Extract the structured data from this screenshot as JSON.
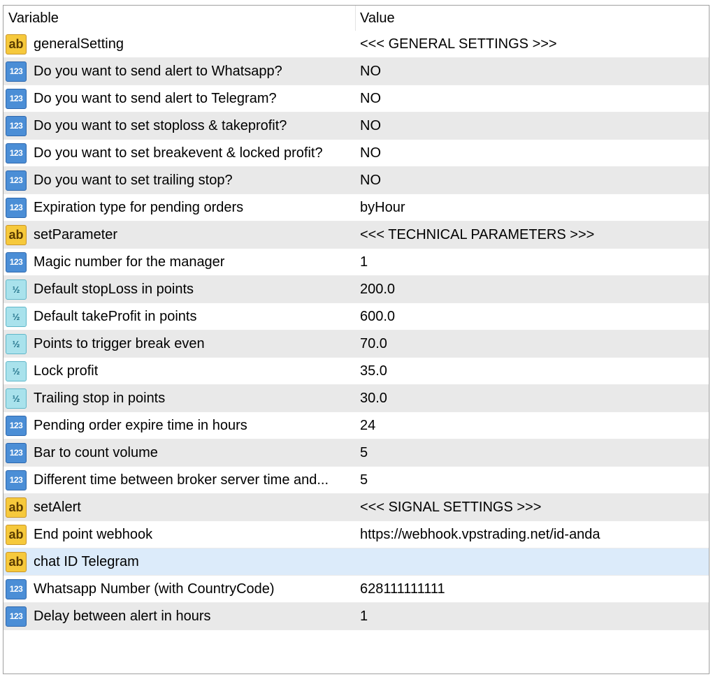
{
  "header": {
    "variable": "Variable",
    "value": "Value"
  },
  "rows": [
    {
      "type": "ab",
      "variable": "generalSetting",
      "value": "<<< GENERAL SETTINGS >>>"
    },
    {
      "type": "num",
      "variable": "Do you want to send alert to Whatsapp?",
      "value": "NO"
    },
    {
      "type": "num",
      "variable": "Do you want to send alert to Telegram?",
      "value": "NO"
    },
    {
      "type": "num",
      "variable": "Do you want to set stoploss & takeprofit?",
      "value": "NO"
    },
    {
      "type": "num",
      "variable": "Do you want to set breakevent & locked profit?",
      "value": "NO"
    },
    {
      "type": "num",
      "variable": "Do you want to set trailing stop?",
      "value": "NO"
    },
    {
      "type": "num",
      "variable": "Expiration type for pending orders",
      "value": "byHour"
    },
    {
      "type": "ab",
      "variable": "setParameter",
      "value": "<<< TECHNICAL PARAMETERS >>>"
    },
    {
      "type": "num",
      "variable": "Magic number for the manager",
      "value": "1"
    },
    {
      "type": "frac",
      "variable": "Default stopLoss in points",
      "value": "200.0"
    },
    {
      "type": "frac",
      "variable": "Default takeProfit in points",
      "value": "600.0"
    },
    {
      "type": "frac",
      "variable": "Points to trigger break even",
      "value": "70.0"
    },
    {
      "type": "frac",
      "variable": "Lock profit",
      "value": "35.0"
    },
    {
      "type": "frac",
      "variable": "Trailing stop in points",
      "value": "30.0"
    },
    {
      "type": "num",
      "variable": "Pending order expire time in hours",
      "value": "24"
    },
    {
      "type": "num",
      "variable": "Bar to count volume",
      "value": "5"
    },
    {
      "type": "num",
      "variable": "Different time between broker server time and...",
      "value": "5"
    },
    {
      "type": "ab",
      "variable": "setAlert",
      "value": "<<< SIGNAL SETTINGS >>>"
    },
    {
      "type": "ab",
      "variable": "End point webhook",
      "value": "https://webhook.vpstrading.net/id-anda"
    },
    {
      "type": "ab",
      "variable": "chat ID Telegram",
      "value": "",
      "selected": true
    },
    {
      "type": "num",
      "variable": "Whatsapp Number (with CountryCode)",
      "value": "628111111111"
    },
    {
      "type": "num",
      "variable": "Delay between alert in hours",
      "value": "1"
    }
  ],
  "icons": {
    "ab": {
      "name": "string-type-icon",
      "glyph": "ab"
    },
    "num": {
      "name": "integer-type-icon",
      "glyph": "123"
    },
    "frac": {
      "name": "double-type-icon",
      "glyph": "½"
    }
  }
}
